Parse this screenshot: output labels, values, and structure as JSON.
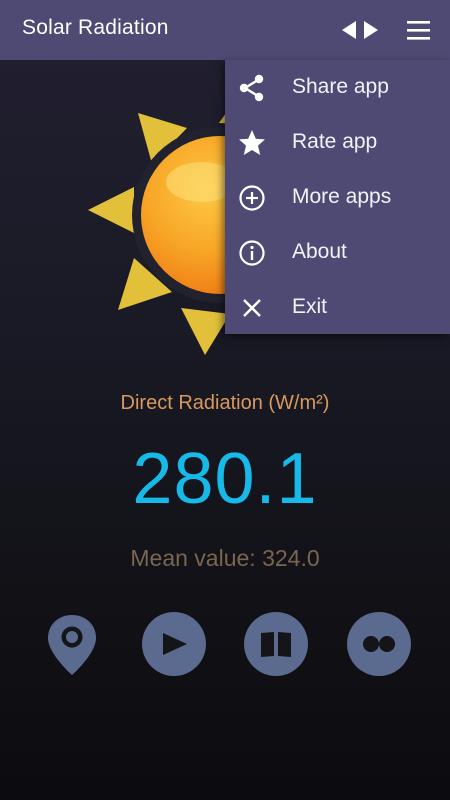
{
  "app": {
    "title": "Solar Radiation"
  },
  "menu": {
    "items": [
      {
        "label": "Share app",
        "icon": "share-icon"
      },
      {
        "label": "Rate app",
        "icon": "star-icon"
      },
      {
        "label": "More apps",
        "icon": "plus-circle-icon"
      },
      {
        "label": "About",
        "icon": "info-icon"
      },
      {
        "label": "Exit",
        "icon": "close-icon"
      }
    ]
  },
  "reading": {
    "label": "Direct Radiation (W/m²)",
    "value": "280.1",
    "mean": "Mean value: 324.0"
  },
  "toolbar": {
    "buttons": [
      "location-pin-icon",
      "play-icon",
      "book-icon",
      "two-dots-icon"
    ]
  },
  "colors": {
    "appbar": "#4e4a74",
    "value": "#16b9e8",
    "label": "#d89a5c",
    "mean": "#7a6650",
    "button": "#5b6a8f"
  }
}
